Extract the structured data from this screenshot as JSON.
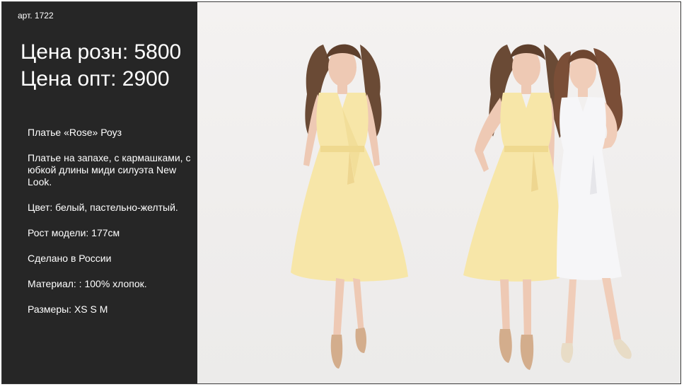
{
  "product": {
    "article": "арт. 1722",
    "price_retail": "Цена розн: 5800",
    "price_wholesale": "Цена опт: 2900",
    "description": [
      "Платье «Rose» Роуз",
      "Платье на запахе, с кармашками, с юбкой длины миди силуэта New Look.",
      "Цвет: белый, пастельно-желтый.",
      "Рост модели: 177см",
      "Сделано в России",
      "Материал: : 100% хлопок.",
      "Размеры: XS S M"
    ]
  },
  "colors": {
    "panel": "#262626",
    "dress_yellow": "#f7e6a8",
    "dress_white": "#f6f6f8",
    "background": "#f1efee"
  }
}
